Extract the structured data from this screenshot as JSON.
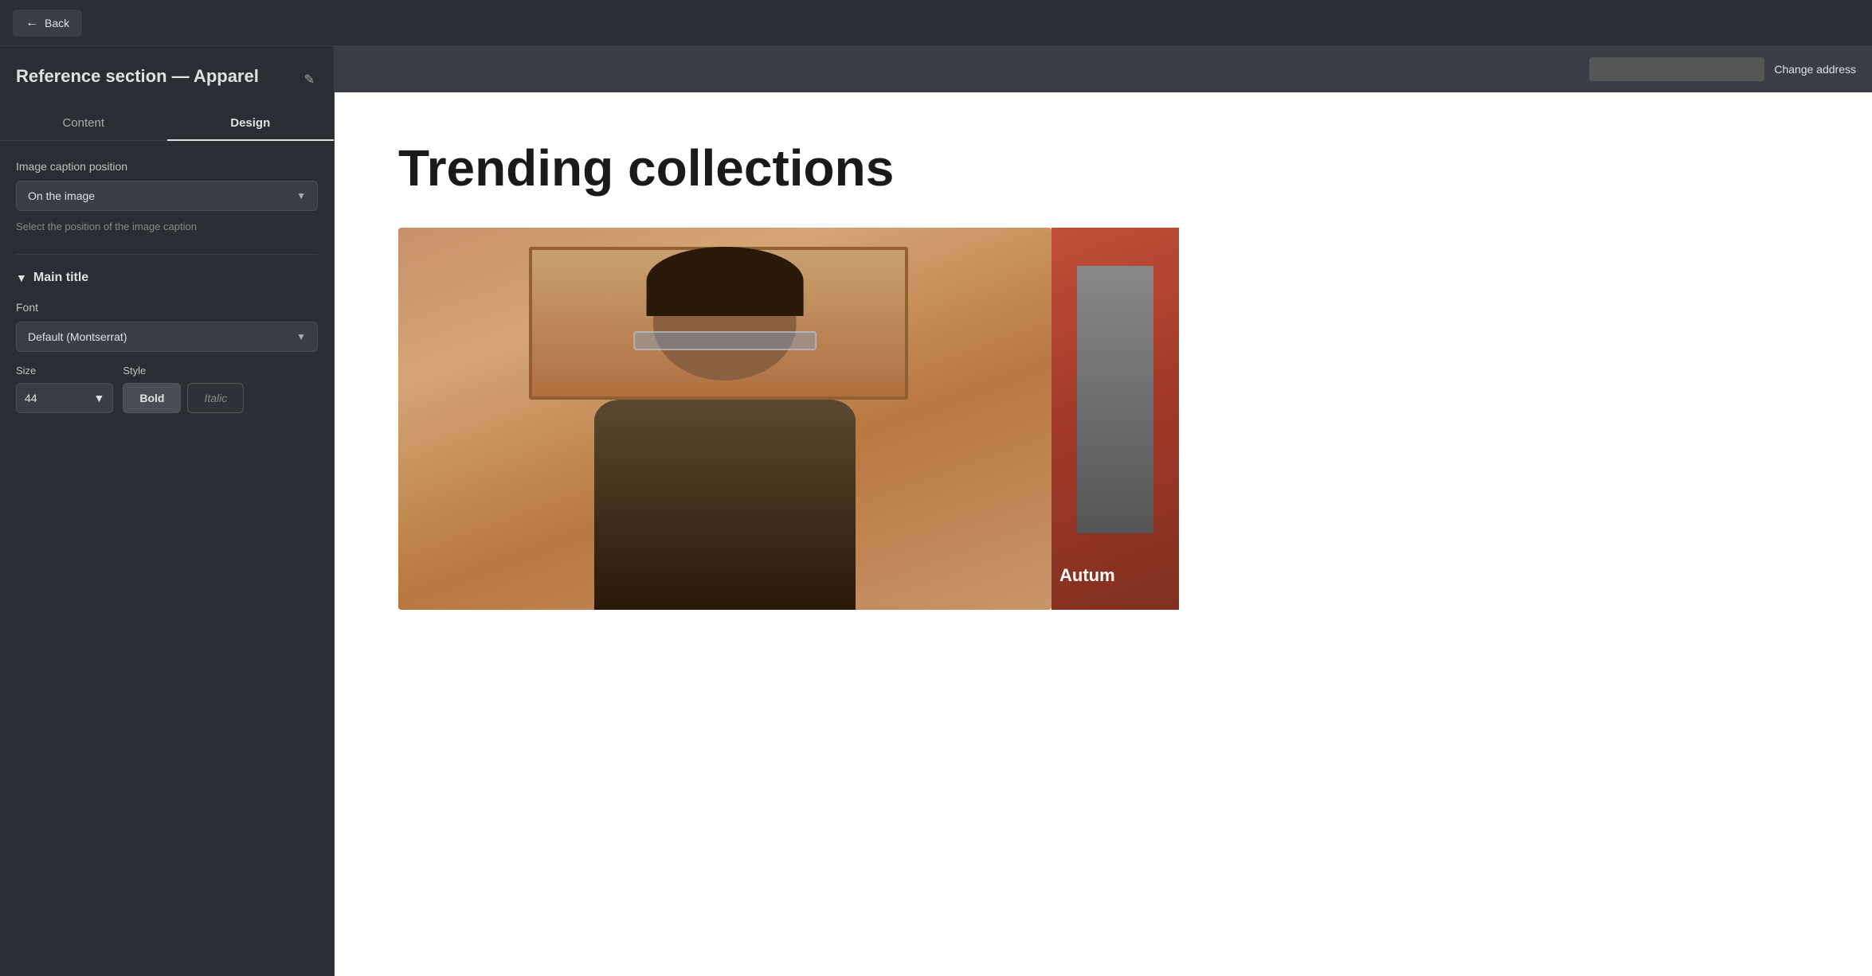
{
  "topbar": {
    "back_label": "Back"
  },
  "sidebar": {
    "section_title": "Reference section — Apparel",
    "edit_icon": "✎",
    "tabs": [
      {
        "id": "content",
        "label": "Content",
        "active": false
      },
      {
        "id": "design",
        "label": "Design",
        "active": true
      }
    ],
    "image_caption_position": {
      "label": "Image caption position",
      "selected_value": "On the image",
      "helper_text": "Select the position of the image caption"
    },
    "main_title_section": {
      "label": "Main title",
      "collapsed": false
    },
    "font_field": {
      "label": "Font",
      "selected_value": "Default (Montserrat)"
    },
    "size_field": {
      "label": "Size",
      "selected_value": "44"
    },
    "style_field": {
      "label": "Style",
      "bold_label": "Bold",
      "italic_label": "Italic"
    }
  },
  "preview": {
    "change_address_label": "Change address",
    "trending_title": "Trending collections",
    "second_image_partial_text": "Autum"
  }
}
